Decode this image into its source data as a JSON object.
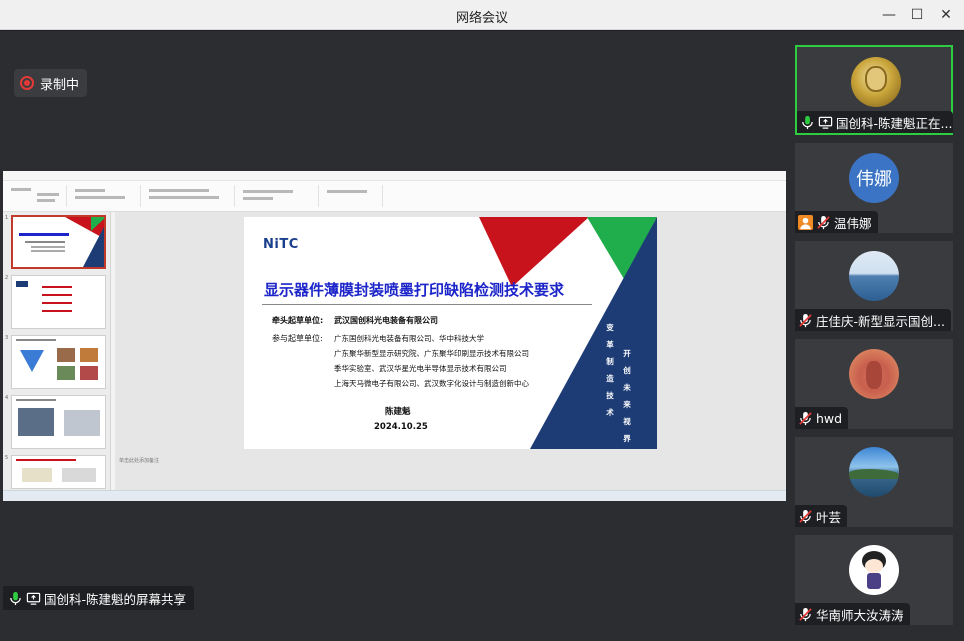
{
  "window": {
    "title": "网络会议"
  },
  "recording": {
    "label": "录制中",
    "color": "#e53935"
  },
  "slide": {
    "logo": "NiTC",
    "title": "显示器件薄膜封装喷墨打印缺陷检测技术要求",
    "lead_label": "牵头起草单位:",
    "lead_org": "武汉国创科光电装备有限公司",
    "participants_label": "参与起草单位:",
    "participants": [
      "广东聚华新型显示研究院、广东聚华印刷显示技术有限公司",
      "季华实验室、武汉华星光电半导体显示技术有限公司",
      "上海天马微电子有限公司、武汉数字化设计与制造创新中心"
    ],
    "participants_first": "广东国创科光电装备有限公司、华中科技大学",
    "author": "陈建魁",
    "date": "2024.10.25",
    "vertical_left": [
      "变",
      "革",
      "制",
      "造",
      "技",
      "术"
    ],
    "vertical_right": [
      "开",
      "创",
      "未",
      "来",
      "视",
      "界"
    ],
    "colors": {
      "red": "#c8121c",
      "green": "#1fae4b",
      "navy": "#1d3c76",
      "title": "#1c25c9"
    }
  },
  "ppt": {
    "notes_placeholder": "单击此处添加备注"
  },
  "participants": [
    {
      "name": "国创科-陈建魁正在...",
      "avatar": "photo-gold",
      "mic": "on",
      "sharing": true
    },
    {
      "name": "温伟娜",
      "avatar_text": "伟娜",
      "mic": "muted",
      "host": true
    },
    {
      "name": "庄佳庆-新型显示国创...",
      "avatar": "photo-sea",
      "mic": "muted"
    },
    {
      "name": "hwd",
      "avatar": "photo-orange",
      "mic": "muted"
    },
    {
      "name": "叶芸",
      "avatar": "photo-coast",
      "mic": "muted"
    },
    {
      "name": "华南师大汝涛涛",
      "avatar": "photo-cartoon",
      "mic": "muted"
    }
  ],
  "screen_share": {
    "label": "国创科-陈建魁的屏幕共享"
  }
}
